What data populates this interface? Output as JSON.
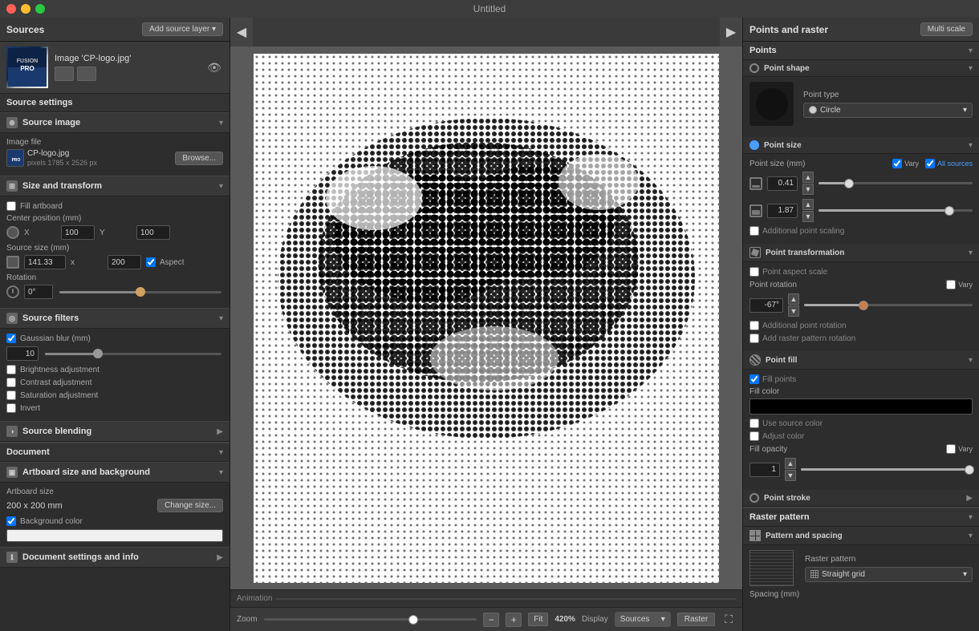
{
  "app": {
    "title": "Untitled"
  },
  "titlebar": {
    "dots": [
      "red",
      "yellow",
      "green"
    ]
  },
  "left": {
    "sources_title": "Sources",
    "add_source_btn": "Add source layer ▾",
    "source_image_name": "Image 'CP-logo.jpg'",
    "source_settings_label": "Source settings",
    "source_image_section": "Source image",
    "image_file_label": "Image file",
    "image_filename": "CP-logo.jpg",
    "image_dimensions": "pixels 1785 x 2526 px",
    "browse_btn": "Browse...",
    "size_transform_section": "Size and transform",
    "fill_artboard_label": "Fill artboard",
    "center_position_label": "Center position (mm)",
    "x_label": "X",
    "x_value": "100",
    "y_label": "Y",
    "y_value": "100",
    "source_size_label": "Source size (mm)",
    "width_value": "141.33",
    "x2_label": "x",
    "height_value": "200",
    "aspect_label": "Aspect",
    "rotation_label": "Rotation",
    "rotation_value": "0°",
    "source_filters_section": "Source filters",
    "gaussian_blur_label": "Gaussian blur (mm)",
    "blur_value": "10",
    "brightness_label": "Brightness adjustment",
    "contrast_label": "Contrast adjustment",
    "saturation_label": "Saturation adjustment",
    "invert_label": "Invert",
    "source_blending_section": "Source blending",
    "document_section": "Document",
    "artboard_section": "Artboard size and background",
    "artboard_size_label": "Artboard size",
    "artboard_dimensions": "200 x 200 mm",
    "change_size_btn": "Change size...",
    "bg_color_label": "Background color",
    "document_settings_label": "Document settings and info"
  },
  "canvas": {
    "zoom_label": "Zoom",
    "zoom_value": "420%",
    "fit_btn": "Fit",
    "display_label": "Display",
    "display_value": "Sources",
    "raster_btn": "Raster",
    "anim_label": "Animation"
  },
  "right": {
    "header_title": "Points and raster",
    "multi_scale_btn": "Multi scale",
    "points_section": "Points",
    "point_shape_subsection": "Point shape",
    "point_type_label": "Point type",
    "point_type_value": "Circle",
    "point_size_subsection": "Point size",
    "point_size_mm_label": "Point size (mm)",
    "vary_label": "Vary",
    "all_sources_label": "All sources",
    "size_value_1": "0.41",
    "size_value_2": "1.87",
    "additional_scaling_label": "Additional point scaling",
    "point_transformation_subsection": "Point transformation",
    "point_aspect_scale_label": "Point aspect scale",
    "point_rotation_label": "Point rotation",
    "vary_rotation_label": "Vary",
    "rotation_deg_value": "-67°",
    "additional_rotation_label": "Additional point rotation",
    "add_raster_rotation_label": "Add raster pattern rotation",
    "point_fill_subsection": "Point fill",
    "fill_points_label": "Fill points",
    "fill_color_label": "Fill color",
    "use_source_color_label": "Use source color",
    "adjust_color_label": "Adjust color",
    "fill_opacity_label": "Fill opacity",
    "opacity_vary_label": "Vary",
    "opacity_value": "1",
    "point_stroke_subsection": "Point stroke",
    "raster_pattern_section": "Raster pattern",
    "pattern_spacing_subsection": "Pattern and spacing",
    "raster_pattern_label": "Raster pattern",
    "raster_pattern_value": "Straight grid",
    "spacing_label": "Spacing (mm)"
  }
}
